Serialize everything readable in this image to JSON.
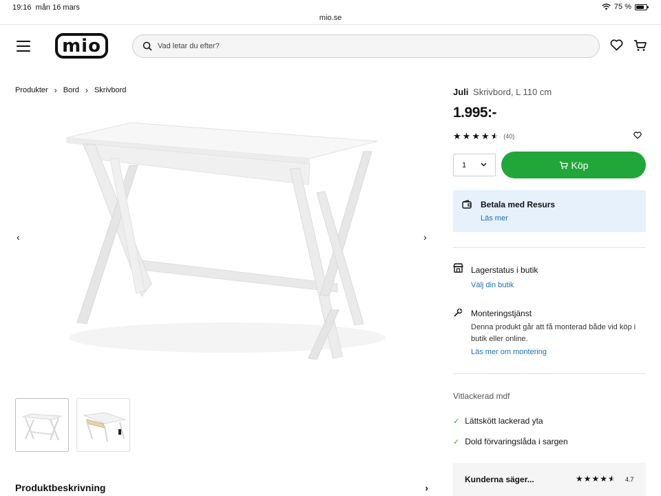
{
  "status_bar": {
    "time": "19:16",
    "date": "mån 16 mars",
    "url": "mio.se",
    "battery": "75 %"
  },
  "header": {
    "logo": "mio",
    "search_placeholder": "Vad letar du efter?",
    "icons": [
      "menu-icon",
      "search-icon",
      "heart-icon",
      "cart-icon"
    ]
  },
  "breadcrumb": [
    "Produkter",
    "Bord",
    "Skrivbord"
  ],
  "gallery": {
    "prev": "‹",
    "next": "›",
    "thumbnails": [
      "desk-front",
      "desk-drawer-open"
    ]
  },
  "description_section": {
    "label": "Produktbeskrivning"
  },
  "product": {
    "brand": "Juli",
    "name": "Skrivbord, L 110 cm",
    "price": "1.995:-",
    "rating_stars": 4.5,
    "review_count": "(40)",
    "quantity": "1",
    "buy_label": "Köp"
  },
  "payment": {
    "title": "Betala med Resurs",
    "link": "Läs mer"
  },
  "stock": {
    "title": "Lagerstatus i butik",
    "link": "Välj din butik"
  },
  "assembly": {
    "title": "Monteringstjänst",
    "text": "Denna produkt går att få monterad både vid köp i butik eller online.",
    "link": "Läs mer om montering"
  },
  "material": "Vitlackerad mdf",
  "features": [
    "Lättskött lackerad yta",
    "Dold förvaringslåda i sargen"
  ],
  "reviews": {
    "label": "Kunderna säger...",
    "score": "4.7",
    "stars": 4.5
  },
  "colors": {
    "buy_green": "#21a63a",
    "link_blue": "#1d6fb8",
    "resurs_bg": "#e6f1fb"
  }
}
